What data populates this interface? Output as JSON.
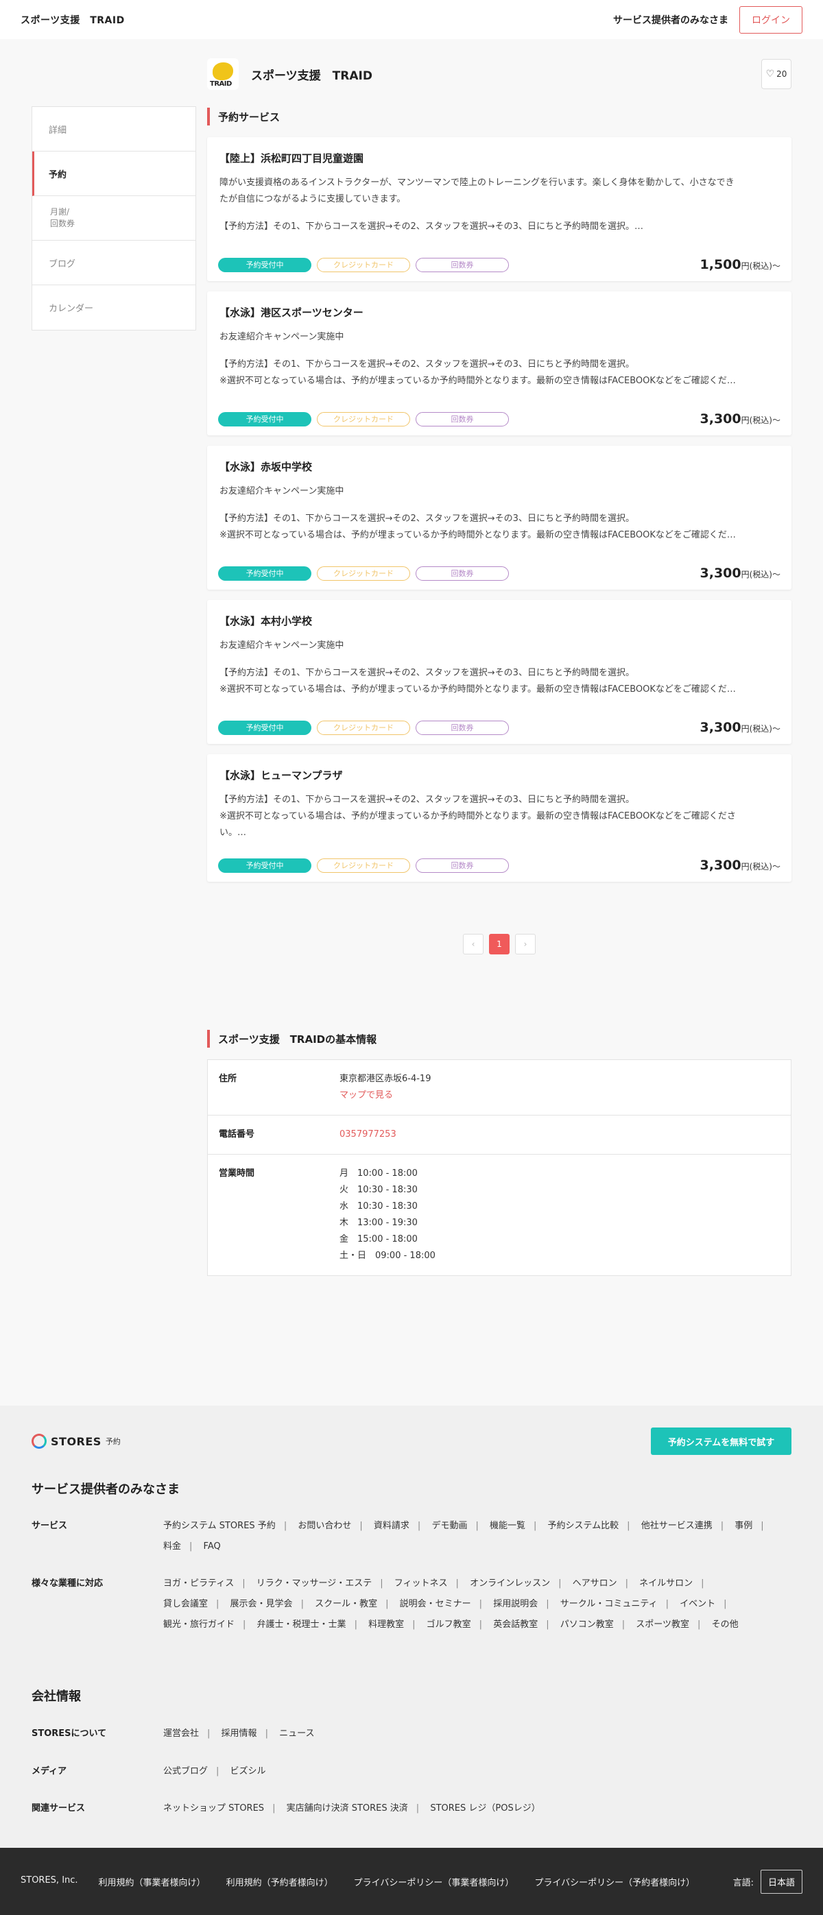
{
  "header": {
    "brand": "スポーツ支援　TRAID",
    "provider_link": "サービス提供者のみなさま",
    "login_label": "ログイン"
  },
  "shop": {
    "logo_text": "TRAID",
    "name": "スポーツ支援　TRAID",
    "favorite_count": "20"
  },
  "nav": {
    "items": [
      {
        "label": "詳細"
      },
      {
        "label": "予約"
      },
      {
        "label_line1": "月謝/",
        "label_line2": "回数券"
      },
      {
        "label": "ブログ"
      },
      {
        "label": "カレンダー"
      }
    ]
  },
  "reservation": {
    "section_title": "予約サービス",
    "tags": {
      "open": "予約受付中",
      "credit": "クレジットカード",
      "ticket": "回数券"
    },
    "price_suffix": "円(税込)〜",
    "services": [
      {
        "title": "【陸上】浜松町四丁目児童遊園",
        "lines": [
          "障がい支援資格のあるインストラクターが、マンツーマンで陸上のトレーニングを行います。楽しく身体を動かして、小さなでき",
          "たが自信につながるように支援していきます。",
          "",
          "【予約方法】その1、下からコースを選択→その2、スタッフを選択→その3、日にちと予約時間を選択。…"
        ],
        "price": "1,500"
      },
      {
        "title": "【水泳】港区スポーツセンター",
        "lines": [
          "お友達紹介キャンペーン実施中",
          "",
          "【予約方法】その1、下からコースを選択→その2、スタッフを選択→その3、日にちと予約時間を選択。",
          "※選択不可となっている場合は、予約が埋まっているか予約時間外となります。最新の空き情報はFACEBOOKなどをご確認くだ…"
        ],
        "price": "3,300"
      },
      {
        "title": "【水泳】赤坂中学校",
        "lines": [
          "お友達紹介キャンペーン実施中",
          "",
          "【予約方法】その1、下からコースを選択→その2、スタッフを選択→その3、日にちと予約時間を選択。",
          "※選択不可となっている場合は、予約が埋まっているか予約時間外となります。最新の空き情報はFACEBOOKなどをご確認くだ…"
        ],
        "price": "3,300"
      },
      {
        "title": "【水泳】本村小学校",
        "lines": [
          "お友達紹介キャンペーン実施中",
          "",
          "【予約方法】その1、下からコースを選択→その2、スタッフを選択→その3、日にちと予約時間を選択。",
          "※選択不可となっている場合は、予約が埋まっているか予約時間外となります。最新の空き情報はFACEBOOKなどをご確認くだ…"
        ],
        "price": "3,300"
      },
      {
        "title": "【水泳】ヒューマンプラザ",
        "lines": [
          "【予約方法】その1、下からコースを選択→その2、スタッフを選択→その3、日にちと予約時間を選択。",
          "※選択不可となっている場合は、予約が埋まっているか予約時間外となります。最新の空き情報はFACEBOOKなどをご確認くださ",
          "い。…"
        ],
        "price": "3,300"
      }
    ]
  },
  "pagination": {
    "prev": "‹",
    "current": "1",
    "next": "›"
  },
  "info": {
    "section_title": "スポーツ支援　TRAIDの基本情報",
    "address_label": "住所",
    "address": "東京都港区赤坂6-4-19",
    "map_link": "マップで見る",
    "phone_label": "電話番号",
    "phone": "0357977253",
    "hours_label": "営業時間",
    "hours": [
      "月　10:00 - 18:00",
      "火　10:30 - 18:30",
      "水　10:30 - 18:30",
      "木　13:00 - 19:30",
      "金　15:00 - 18:00",
      "土・日　09:00 - 18:00"
    ]
  },
  "footer": {
    "logo_word": "STORES",
    "logo_sub": "予約",
    "trial_button": "予約システムを無料で試す",
    "providers_heading": "サービス提供者のみなさま",
    "service_label": "サービス",
    "service_links_line1": [
      "予約システム STORES 予約",
      "お問い合わせ",
      "資料請求",
      "デモ動画",
      "機能一覧",
      "予約システム比較",
      "他社サービス連携",
      "事例"
    ],
    "service_links_line2": [
      "料金",
      "FAQ"
    ],
    "industry_label": "様々な業種に対応",
    "industry_line1": [
      "ヨガ・ピラティス",
      "リラク・マッサージ・エステ",
      "フィットネス",
      "オンラインレッスン",
      "ヘアサロン",
      "ネイルサロン"
    ],
    "industry_line2": [
      "貸し会議室",
      "展示会・見学会",
      "スクール・教室",
      "説明会・セミナー",
      "採用説明会",
      "サークル・コミュニティ",
      "イベント"
    ],
    "industry_line3": [
      "観光・旅行ガイド",
      "弁護士・税理士・士業",
      "料理教室",
      "ゴルフ教室",
      "英会話教室",
      "パソコン教室",
      "スポーツ教室",
      "その他"
    ],
    "company_heading": "会社情報",
    "about_label": "STORESについて",
    "about_links": [
      "運営会社",
      "採用情報",
      "ニュース"
    ],
    "media_label": "メディア",
    "media_links": [
      "公式ブログ",
      "ビズシル"
    ],
    "related_label": "関連サービス",
    "related_links": [
      "ネットショップ STORES",
      "実店舗向け決済 STORES 決済",
      "STORES レジ（POSレジ）"
    ]
  },
  "bottombar": {
    "links": [
      "STORES, Inc.",
      "利用規約（事業者様向け）",
      "利用規約（予約者様向け）",
      "プライバシーポリシー（事業者様向け）",
      "プライバシーポリシー（予約者様向け）"
    ],
    "lang_label": "言語:",
    "lang_value": "日本語"
  },
  "colors": {
    "accent": "#e25a5a",
    "teal": "#1dc3b8",
    "credit": "#f1c56a",
    "ticket": "#b58ac8"
  }
}
